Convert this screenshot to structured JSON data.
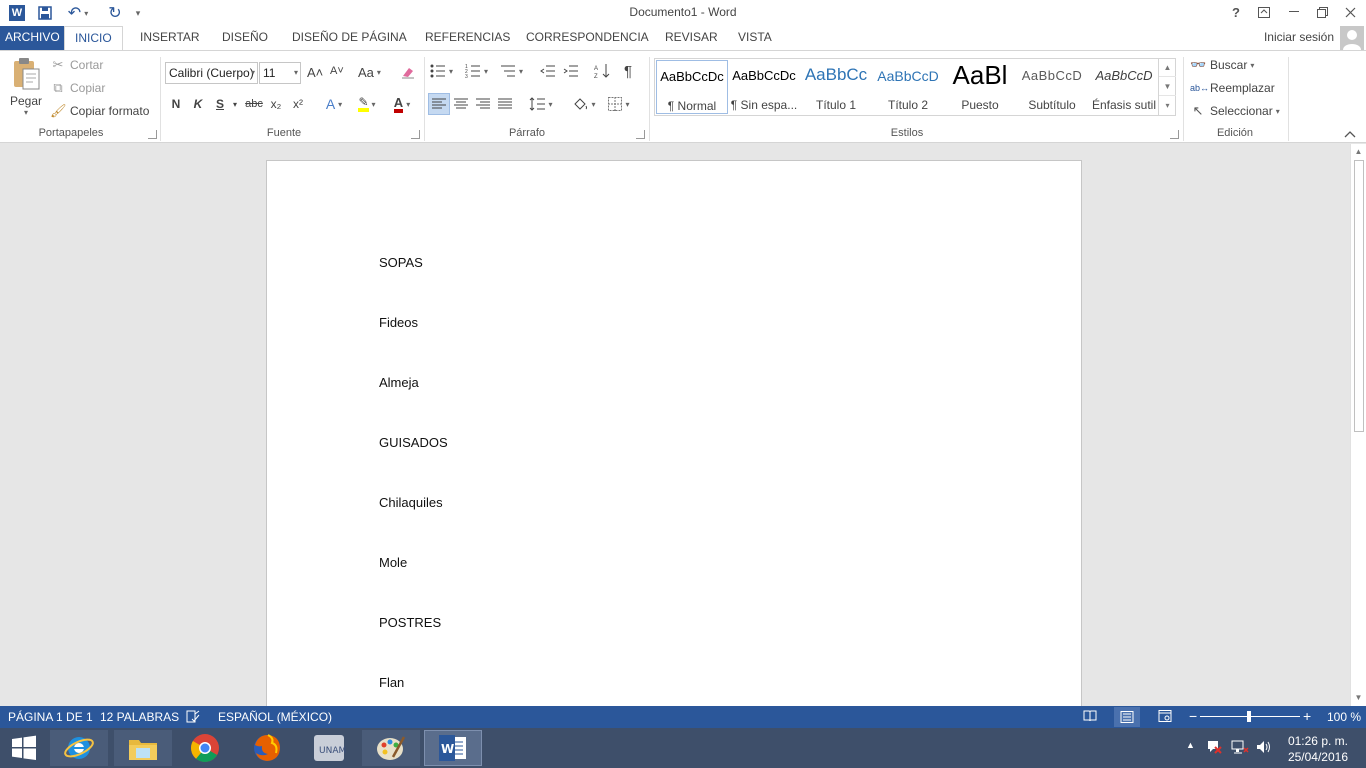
{
  "window": {
    "title": "Documento1 - Word",
    "help": "?",
    "controls": {
      "ribbon_options": "⧉",
      "minimize": "—",
      "restore": "❐",
      "close": "✕"
    }
  },
  "qat": {
    "word_icon": "W",
    "save": "💾",
    "undo": "↶",
    "redo": "↻",
    "customize": "▾"
  },
  "tabs": {
    "file": "ARCHIVO",
    "items": [
      "INICIO",
      "INSERTAR",
      "DISEÑO",
      "DISEÑO DE PÁGINA",
      "REFERENCIAS",
      "CORRESPONDENCIA",
      "REVISAR",
      "VISTA"
    ],
    "active_index": 0,
    "signin": "Iniciar sesión"
  },
  "clipboard": {
    "paste": "Pegar",
    "cut": "Cortar",
    "copy": "Copiar",
    "format_painter": "Copiar formato",
    "label": "Portapapeles"
  },
  "font": {
    "name": "Calibri (Cuerpo)",
    "size": "11",
    "grow": "A˄",
    "shrink": "A˅",
    "case": "Aa",
    "bold": "N",
    "italic": "K",
    "underline": "S",
    "strike": "abc",
    "subscript": "x₂",
    "superscript": "x²",
    "label": "Fuente"
  },
  "paragraph": {
    "label": "Párrafo",
    "pilcrow": "¶"
  },
  "styles": {
    "label": "Estilos",
    "items": [
      {
        "sample": "AaBbCcDc",
        "name": "¶ Normal"
      },
      {
        "sample": "AaBbCcDc",
        "name": "¶ Sin espa..."
      },
      {
        "sample": "AaBbCc",
        "name": "Título 1"
      },
      {
        "sample": "AaBbCcD",
        "name": "Título 2"
      },
      {
        "sample": "AaBl",
        "name": "Puesto"
      },
      {
        "sample": "AaBbCcD",
        "name": "Subtítulo"
      },
      {
        "sample": "AaBbCcD",
        "name": "Énfasis sutil"
      }
    ]
  },
  "editing": {
    "find": "Buscar",
    "replace": "Reemplazar",
    "select": "Seleccionar",
    "label": "Edición"
  },
  "document": {
    "paragraphs": [
      "SOPAS",
      "Fideos",
      "Almeja",
      "GUISADOS",
      "Chilaquiles",
      "Mole",
      "POSTRES",
      "Flan"
    ]
  },
  "status": {
    "page": "PÁGINA 1 DE 1",
    "words": "12 PALABRAS",
    "language": "ESPAÑOL (MÉXICO)",
    "zoom": "100 %",
    "zoom_minus": "−",
    "zoom_plus": "+"
  },
  "taskbar": {
    "time": "01:26 p. m.",
    "date": "25/04/2016",
    "apps": [
      "Internet Explorer",
      "Explorador de archivos",
      "Google Chrome",
      "Firefox",
      "UNAM",
      "Paint",
      "Word"
    ]
  },
  "colors": {
    "accent": "#2b579a",
    "taskbar": "#3e4f6a",
    "highlight": "#ffff00",
    "font_color": "#c00000"
  }
}
